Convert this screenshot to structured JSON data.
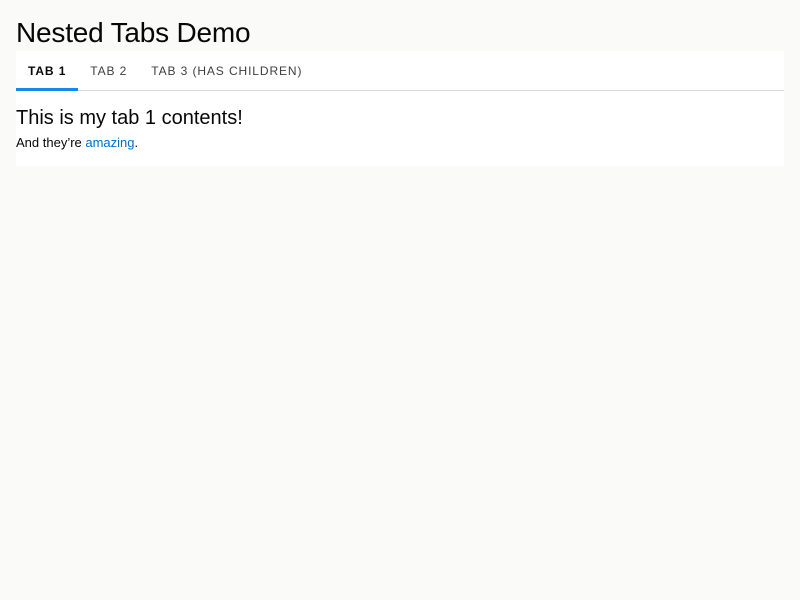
{
  "page": {
    "title": "Nested Tabs Demo"
  },
  "tabs": [
    {
      "label": "Tab 1",
      "active": true
    },
    {
      "label": "Tab 2",
      "active": false
    },
    {
      "label": "Tab 3 (Has Children)",
      "active": false
    }
  ],
  "panel": {
    "heading": "This is my tab 1 contents!",
    "text_before": "And they’re ",
    "link_text": "amazing",
    "text_after": "."
  },
  "colors": {
    "active_tab_indicator": "#1589ee",
    "link": "#006dcc",
    "page_background": "#fafaf9",
    "tab_border": "#dddbda"
  }
}
